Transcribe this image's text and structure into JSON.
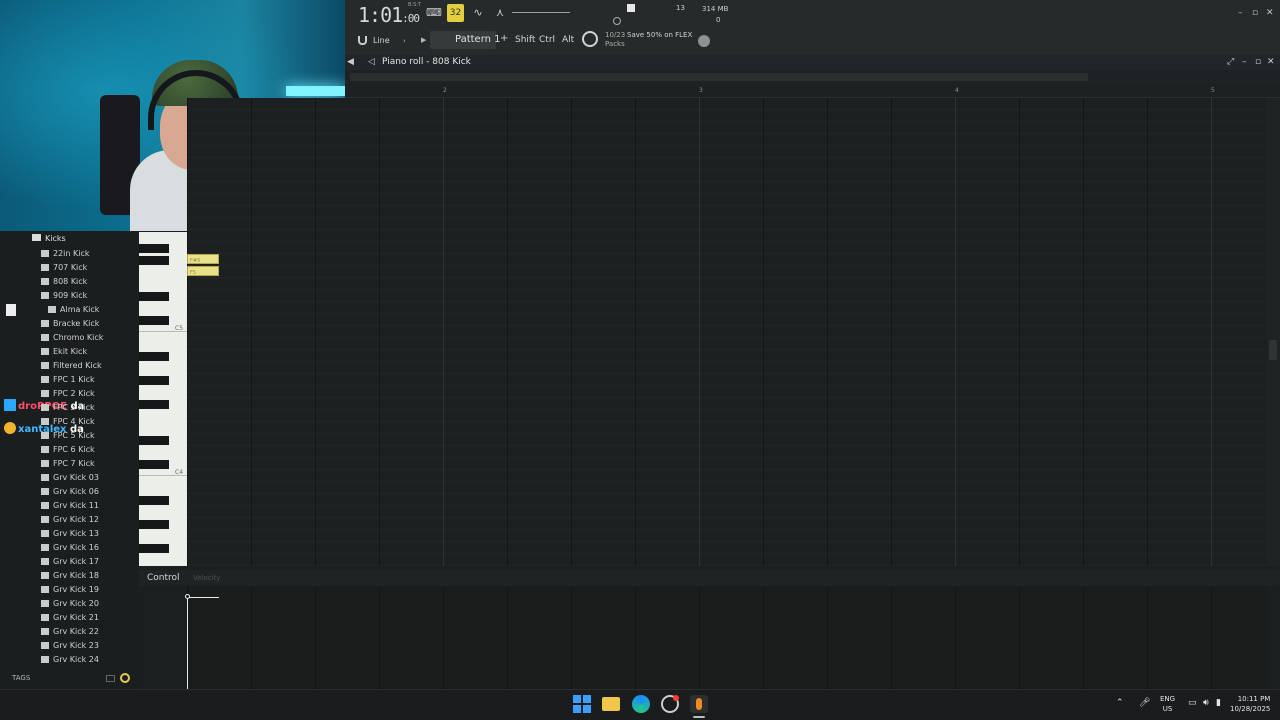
{
  "toolbar": {
    "time_main": "1:01",
    "time_ticks": ":00",
    "time_sup": "B:S:T",
    "tempo_mode_label": "32",
    "cpu": "13",
    "memory": "314 MB",
    "memory_sub": "0",
    "snap_label": "Line",
    "pattern_label": "Pattern 1",
    "shift_label": "Shift",
    "ctrl_label": "Ctrl",
    "alt_label": "Alt",
    "news_count_1": "10/23",
    "news_count_2": "Packs",
    "news_text": "Save 50% on FLEX"
  },
  "piano_roll": {
    "title": "Piano roll - 808 Kick",
    "bars": [
      "2",
      "3",
      "4",
      "5"
    ],
    "notes": [
      {
        "label": "F#5"
      },
      {
        "label": "F5"
      }
    ],
    "key_labels": [
      "C5",
      "C4"
    ]
  },
  "control": {
    "label": "Control",
    "sub_label": "Velocity"
  },
  "browser": {
    "folder": "Kicks",
    "items": [
      "22in Kick",
      "707 Kick",
      "808 Kick",
      "909 Kick",
      "Alma Kick",
      "Bracke Kick",
      "Chromo Kick",
      "Ekit Kick",
      "Filtered Kick",
      "FPC 1 Kick",
      "FPC 2 Kick",
      "FPC 3 Kick",
      "FPC 4 Kick",
      "FPC 5 Kick",
      "FPC 6 Kick",
      "FPC 7 Kick",
      "Grv Kick 03",
      "Grv Kick 06",
      "Grv Kick 11",
      "Grv Kick 12",
      "Grv Kick 13",
      "Grv Kick 16",
      "Grv Kick 17",
      "Grv Kick 18",
      "Grv Kick 19",
      "Grv Kick 20",
      "Grv Kick 21",
      "Grv Kick 22",
      "Grv Kick 23",
      "Grv Kick 24"
    ],
    "tags_label": "TAGS"
  },
  "chat": [
    {
      "user": "droPPOE",
      "message": "da"
    },
    {
      "user": "xantalex",
      "message": "da"
    }
  ],
  "taskbar": {
    "lang_1": "ENG",
    "lang_2": "US",
    "time": "10:11 PM",
    "date": "10/28/2025"
  },
  "colors": {
    "accent_yellow": "#e3cf3e",
    "note_color": "#e9e08a",
    "background": "#1c1f1f"
  },
  "icons": [
    "metronome-icon",
    "waveform-icon",
    "record-icon",
    "stop-icon",
    "speaker-icon",
    "search-icon",
    "folder-icon"
  ]
}
